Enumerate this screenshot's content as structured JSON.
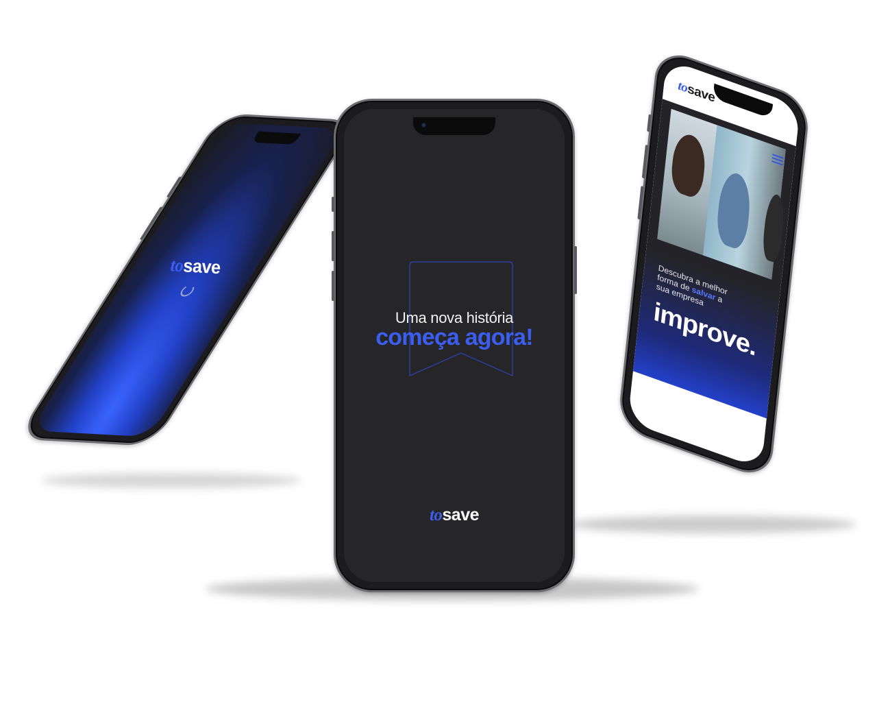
{
  "center_screen": {
    "headline_line1": "Uma nova história",
    "headline_line2": "começa agora!",
    "logo_to": "to",
    "logo_save": "save"
  },
  "left_screen": {
    "logo_to": "to",
    "logo_save": "save"
  },
  "right_screen": {
    "logo_to": "to",
    "logo_save": "save",
    "hero_line1": "Descubra a melhor",
    "hero_line2_a": "forma de ",
    "hero_line2_highlight": "salvar",
    "hero_line2_b": " a",
    "hero_line3": "sua empresa",
    "hero_big": "improve."
  },
  "colors": {
    "brand_blue": "#3b5ef0",
    "screen_dark": "#262628",
    "background": "#ffffff"
  }
}
